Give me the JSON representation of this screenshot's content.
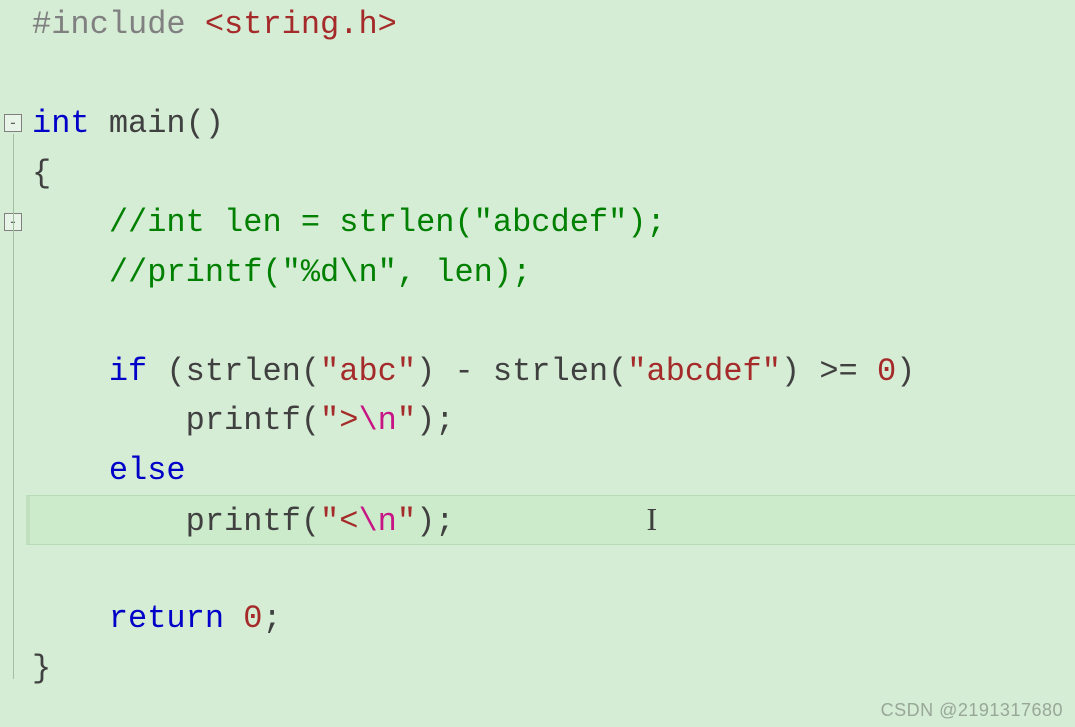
{
  "code": {
    "include_directive": "#include",
    "include_header": "<string.h>",
    "kw_int": "int",
    "main_ident": "main",
    "paren_pair": "()",
    "brace_open": "{",
    "brace_close": "}",
    "comment_strlen": "//int len = strlen(\"abcdef\");",
    "comment_printf": "//printf(\"%d\\n\", len);",
    "kw_if": "if",
    "if_open": " (",
    "strlen1": "strlen",
    "p_open": "(",
    "str_abc": "\"abc\"",
    "p_close": ")",
    "minus": " - ",
    "strlen2": "strlen",
    "str_abcdef": "\"abcdef\"",
    "ge_zero": " >= ",
    "zero": "0",
    "if_close": ")",
    "printf_ident": "printf",
    "str_gt_open": "\">",
    "esc_n": "\\n",
    "str_close": "\"",
    "call_end": ");",
    "kw_else": "else",
    "str_lt_open": "\"<",
    "kw_return": "return",
    "ret_zero": " 0",
    "semicolon": ";"
  },
  "fold_markers": {
    "minus": "-"
  },
  "caret_glyph": "I",
  "watermark": "CSDN @2191317680"
}
